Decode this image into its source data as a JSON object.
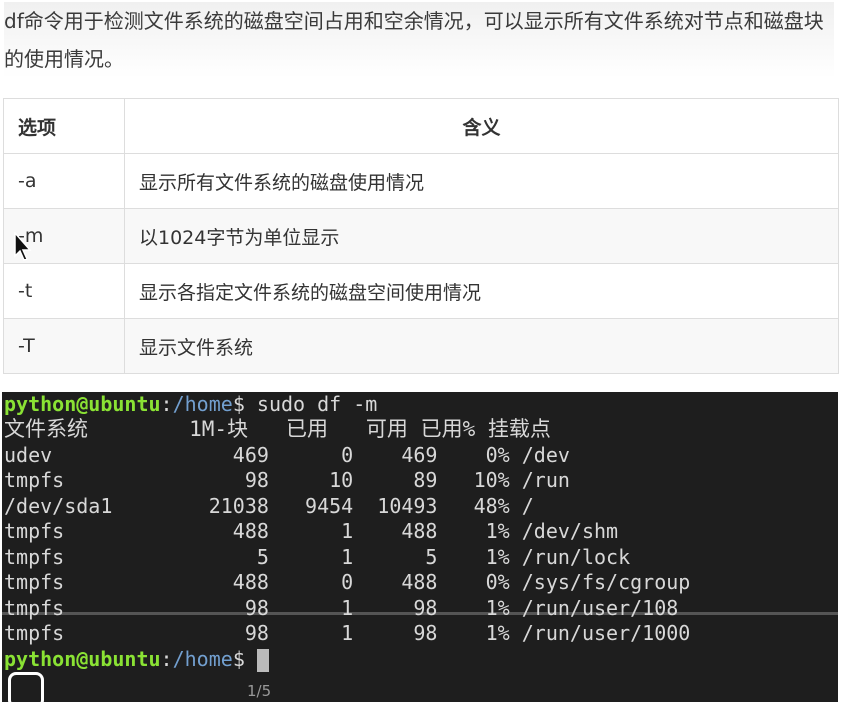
{
  "intro": "df命令用于检测文件系统的磁盘空间占用和空余情况，可以显示所有文件系统对节点和磁盘块的使用情况。",
  "table": {
    "headers": [
      "选项",
      "含义"
    ],
    "rows": [
      {
        "opt": "-a",
        "desc": "显示所有文件系统的磁盘使用情况"
      },
      {
        "opt": "-m",
        "desc": "以1024字节为单位显示"
      },
      {
        "opt": "-t",
        "desc": "显示各指定文件系统的磁盘空间使用情况"
      },
      {
        "opt": "-T",
        "desc": "显示文件系统"
      }
    ]
  },
  "terminal": {
    "user": "python@ubuntu",
    "path": "/home",
    "command": "sudo df -m",
    "header": "文件系统        1M-块   已用   可用 已用% 挂载点",
    "rows": [
      "udev               469      0    469    0% /dev",
      "tmpfs               98     10     89   10% /run",
      "/dev/sda1        21038   9454  10493   48% /",
      "tmpfs              488      1    488    1% /dev/shm",
      "tmpfs                5      1      5    1% /run/lock",
      "tmpfs              488      0    488    0% /sys/fs/cgroup",
      "tmpfs               98      1     98    1% /run/user/108",
      "tmpfs               98      1     98    1% /run/user/1000"
    ]
  },
  "pager": "1/5"
}
